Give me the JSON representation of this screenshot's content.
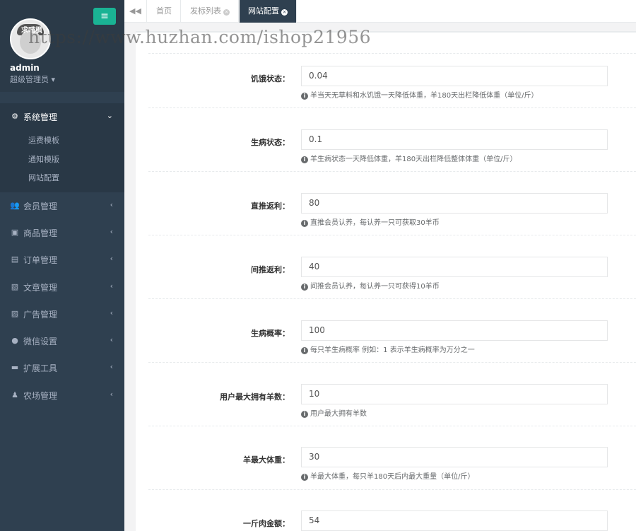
{
  "sidebar": {
    "admin_name": "admin",
    "admin_role": "超级管理员 ▾",
    "avatar_text": "求喵枫",
    "toggle_icon": "≡",
    "active_group": {
      "label": "系统管理",
      "icon": "gear-icon",
      "arrow": "⌄",
      "items": [
        "运费模板",
        "通知模版",
        "网站配置"
      ]
    },
    "groups": [
      {
        "label": "会员管理",
        "icon": "users-icon",
        "glyph": "👥",
        "arrow": "‹"
      },
      {
        "label": "商品管理",
        "icon": "gift-icon",
        "glyph": "▣",
        "arrow": "‹"
      },
      {
        "label": "订单管理",
        "icon": "cart-icon",
        "glyph": "▤",
        "arrow": "‹"
      },
      {
        "label": "文章管理",
        "icon": "copy-icon",
        "glyph": "▧",
        "arrow": "‹"
      },
      {
        "label": "广告管理",
        "icon": "picture-icon",
        "glyph": "▨",
        "arrow": "‹"
      },
      {
        "label": "微信设置",
        "icon": "wechat-icon",
        "glyph": "●",
        "arrow": "‹"
      },
      {
        "label": "扩展工具",
        "icon": "tools-icon",
        "glyph": "▬",
        "arrow": "‹"
      },
      {
        "label": "农场管理",
        "icon": "user-icon",
        "glyph": "♟",
        "arrow": "‹"
      }
    ]
  },
  "tabs": {
    "back_icon": "◀◀",
    "items": [
      {
        "label": "首页",
        "closable": false
      },
      {
        "label": "发标列表",
        "closable": true
      },
      {
        "label": "网站配置",
        "closable": true,
        "active": true
      }
    ],
    "close_glyph": "×"
  },
  "watermark": "https://www.huzhan.com/ishop21956",
  "form": {
    "info_glyph": "i",
    "fields": [
      {
        "label": "饥饿状态：",
        "value": "0.04",
        "help": "羊当天无草料和水饥饿一天降低体重，羊180天出栏降低体重（单位/斤）"
      },
      {
        "label": "生病状态：",
        "value": "0.1",
        "help": "羊生病状态一天降低体重，羊180天出栏降低整体体重（单位/斤）"
      },
      {
        "label": "直推返利：",
        "value": "80",
        "help": "直推会员认养，每认养一只可获取30羊币"
      },
      {
        "label": "间推返利：",
        "value": "40",
        "help": "间推会员认养，每认养一只可获得10羊币"
      },
      {
        "label": "生病概率：",
        "value": "100",
        "help": "每只羊生病概率 例如：1 表示羊生病概率为万分之一"
      },
      {
        "label": "用户最大拥有羊数：",
        "value": "10",
        "help": "用户最大拥有羊数"
      },
      {
        "label": "羊最大体重：",
        "value": "30",
        "help": "羊最大体重，每只羊180天后内最大重量（单位/斤）"
      },
      {
        "label": "一斤肉金额：",
        "value": "54",
        "help": ""
      }
    ]
  }
}
